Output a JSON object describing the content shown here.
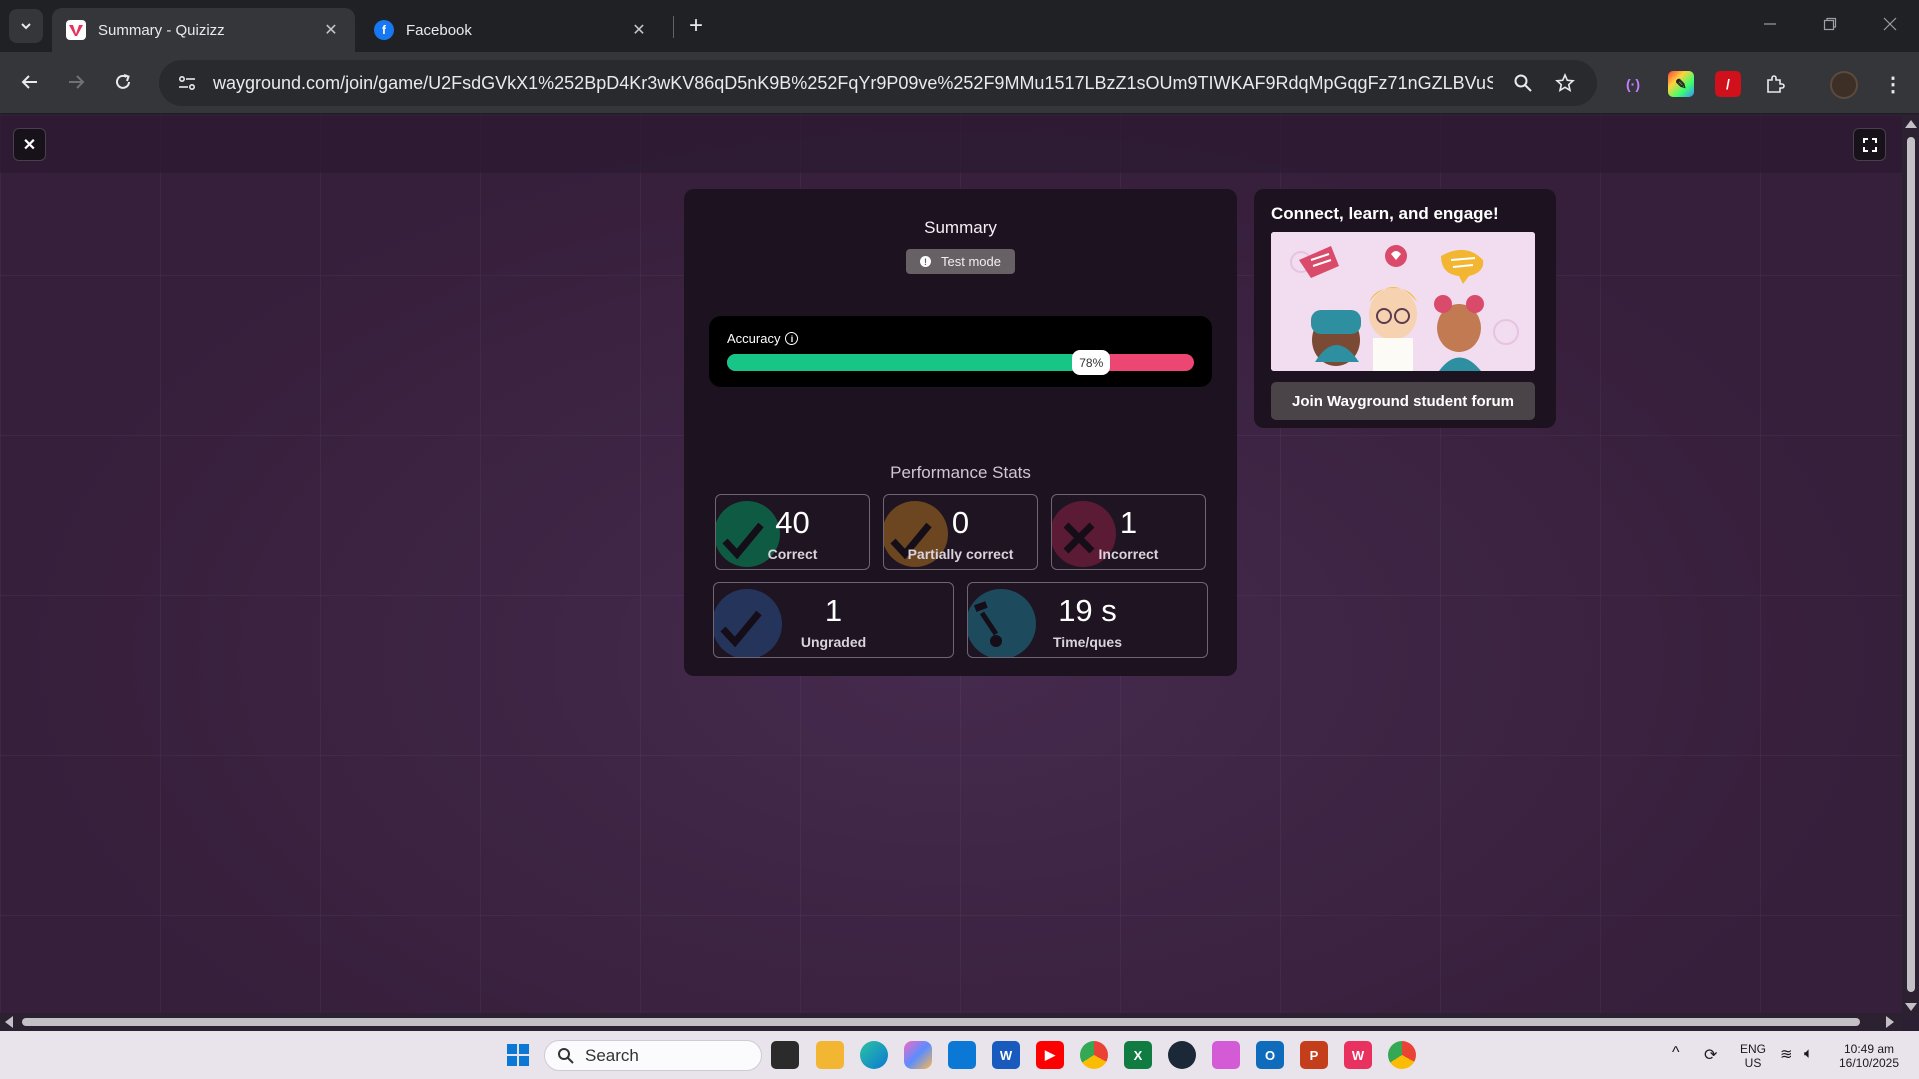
{
  "browser": {
    "tabs": [
      {
        "title": "Summary - Quizizz",
        "active": true,
        "favicon": "quizizz-icon"
      },
      {
        "title": "Facebook",
        "active": false,
        "favicon": "facebook-icon"
      }
    ],
    "url": "wayground.com/join/game/U2FsdGVkX1%252BpD4Kr3wKV86qD5nK9B%252FqYr9P09ve%252F9MMu1517LBzZ1sOUm9TIWKAF9RdqMpGqgFz71nGZLBVuSV..."
  },
  "summary": {
    "title": "Summary",
    "mode_badge": "Test mode",
    "accuracy": {
      "label": "Accuracy",
      "value": 0.78,
      "value_label": "78%",
      "correct_color": "#17c586",
      "incorrect_color": "#ec4673"
    },
    "performance_title": "Performance Stats",
    "stats": [
      {
        "value": "40",
        "label": "Correct",
        "color": "#0f5a43",
        "icon": "checkmark-icon"
      },
      {
        "value": "0",
        "label": "Partially correct",
        "color": "#6b4621",
        "icon": "checkmark-icon"
      },
      {
        "value": "1",
        "label": "Incorrect",
        "color": "#5c1b35",
        "icon": "cross-icon"
      },
      {
        "value": "1",
        "label": "Ungraded",
        "color": "#25345b",
        "icon": "checkmark-icon"
      },
      {
        "value": "19 s",
        "label": "Time/ques",
        "color": "#1d4a5c",
        "icon": "stopwatch-icon"
      }
    ]
  },
  "side": {
    "title": "Connect, learn, and engage!",
    "button": "Join Wayground student forum"
  },
  "taskbar": {
    "search_placeholder": "Search",
    "language": "ENG",
    "region": "US",
    "time": "10:49 am",
    "date": "16/10/2025"
  }
}
